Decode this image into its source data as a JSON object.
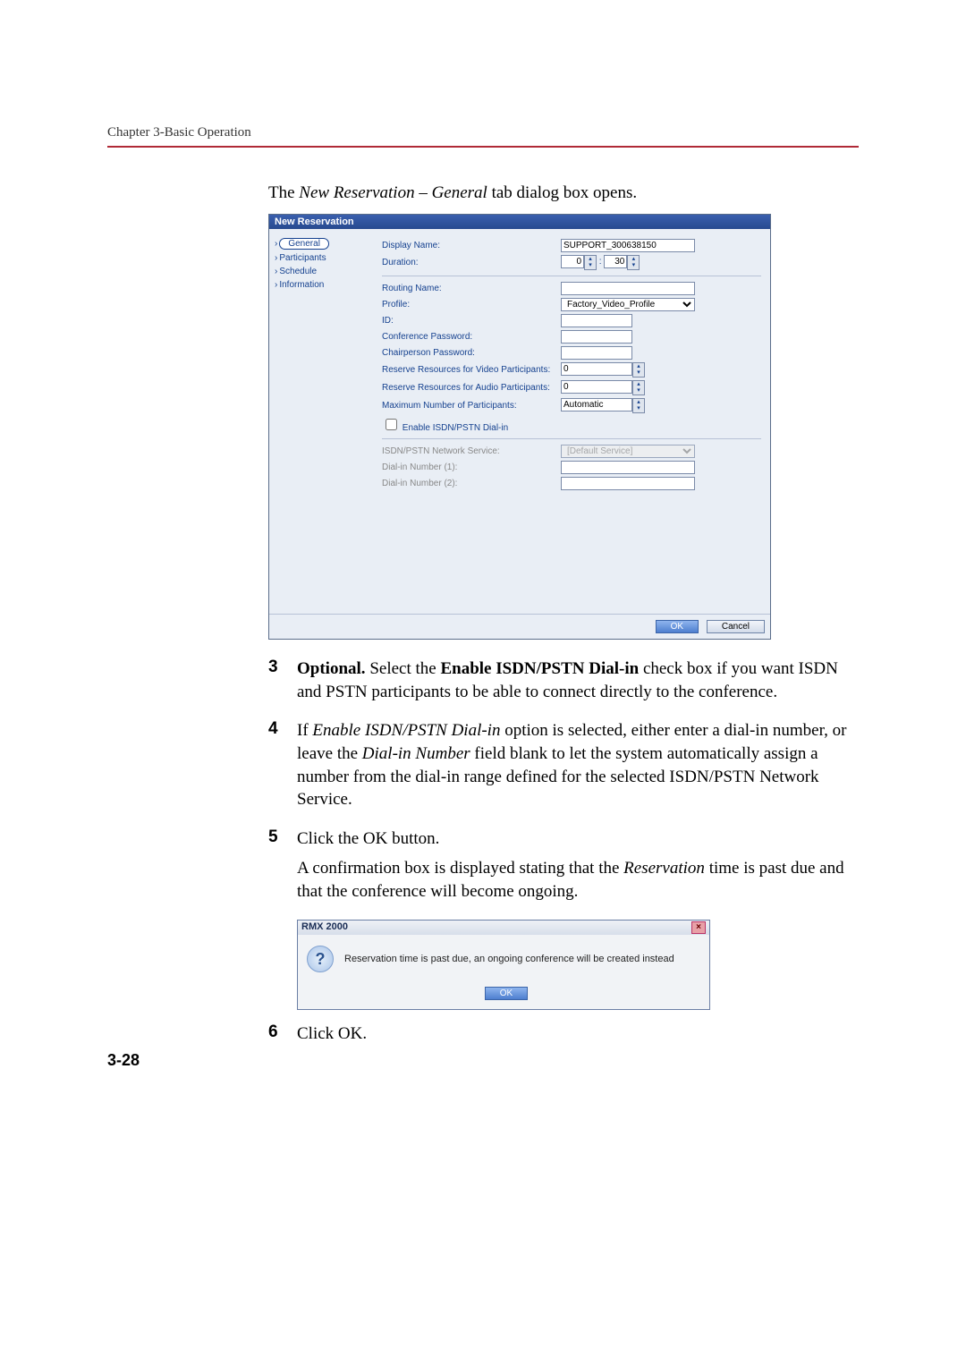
{
  "header": {
    "chapter": "Chapter 3-Basic Operation"
  },
  "lead": {
    "pre": "The ",
    "ital": "New Reservation – General",
    "post": " tab dialog box opens."
  },
  "dialog": {
    "title": "New Reservation",
    "nav": {
      "general": "General",
      "participants": "Participants",
      "schedule": "Schedule",
      "information": "Information"
    },
    "labels": {
      "display_name": "Display Name:",
      "duration": "Duration:",
      "routing": "Routing Name:",
      "profile": "Profile:",
      "id": "ID:",
      "conf_pw": "Conference Password:",
      "chair_pw": "Chairperson Password:",
      "reserve_video": "Reserve Resources for Video Participants:",
      "reserve_audio": "Reserve Resources for Audio Participants:",
      "max_part": "Maximum Number of Participants:",
      "enable_isdn": "Enable ISDN/PSTN Dial-in",
      "isdn_service": "ISDN/PSTN Network Service:",
      "dialin1": "Dial-in Number (1):",
      "dialin2": "Dial-in Number (2):"
    },
    "values": {
      "display_name": "SUPPORT_300638150",
      "duration_h": "0",
      "duration_m": "30",
      "profile": "Factory_Video_Profile",
      "reserve_video": "0",
      "reserve_audio": "0",
      "max_part": "Automatic",
      "isdn_service": "[Default Service]"
    },
    "buttons": {
      "ok": "OK",
      "cancel": "Cancel"
    }
  },
  "steps": {
    "s3": {
      "num": "3",
      "bold1": "Optional.",
      "mid1": " Select the ",
      "bold2": "Enable ISDN/PSTN Dial-in",
      "rest": " check box if you want ISDN and PSTN participants to be able to connect directly to the conference."
    },
    "s4": {
      "num": "4",
      "t1": "If ",
      "i1": "Enable ISDN/PSTN Dial-in",
      "t2": " option is selected, either enter a dial-in number, or leave the ",
      "i2": "Dial-in Number",
      "t3": " field blank to let the system automatically assign a number from the dial-in range defined for the selected ISDN/PSTN Network Service."
    },
    "s5": {
      "num": "5",
      "p1": "Click the OK button.",
      "p2a": "A confirmation box is displayed stating that the ",
      "p2i": "Reservation",
      "p2b": " time is past due and that the conference will become ongoing."
    },
    "s6": {
      "num": "6",
      "text": "Click OK."
    }
  },
  "confirm": {
    "title": "RMX 2000",
    "message": "Reservation time is past due, an ongoing conference will be created instead",
    "ok": "OK"
  },
  "page_number": "3-28"
}
